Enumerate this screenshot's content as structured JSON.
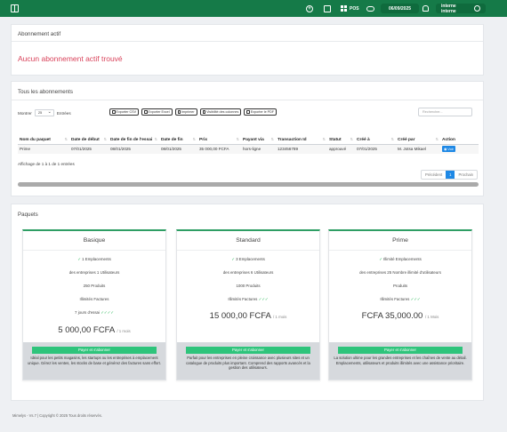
{
  "topbar": {
    "pos_label": "POS",
    "date": "06/09/2025",
    "user": "interne interne"
  },
  "active_subscription": {
    "title": "Abonnement actif",
    "empty_message": "Aucun abonnement actif trouvé"
  },
  "subscriptions": {
    "title": "Tous les abonnements",
    "show_label": "Montrer",
    "page_size": "25",
    "entries_label": "Entrées",
    "exports": [
      "Exporter CSV",
      "Exporter Excel",
      "Imprimer",
      "Visibilité des colonnes",
      "Exporter le PDF"
    ],
    "search_placeholder": "Rechercher...",
    "columns": [
      "Nom du paquet",
      "Date de début",
      "Date de fin de l'essai",
      "Date de fin",
      "Prix",
      "Payant via",
      "Transaction Id",
      "Statut",
      "Créé à",
      "Créé par",
      "Action"
    ],
    "rows": [
      {
        "package": "Prime",
        "start": "07/01/2025",
        "trial_end": "08/01/2025",
        "end": "08/01/2025",
        "price": "35 000,00 FCFA",
        "paid_via": "hors-ligne",
        "transaction_id": "123456789",
        "status": "approuvé",
        "created_at": "07/01/2025",
        "created_by": "M. Jotsa Mikael",
        "action": "Voir"
      }
    ],
    "info": "Affichage de 1 à 1 de 1 entrées",
    "pager": {
      "prev": "Précédent",
      "current": "1",
      "next": "Prochain"
    }
  },
  "packages": {
    "title": "Paquets",
    "items": [
      {
        "name": "Basique",
        "features": [
          "1 Emplacements",
          "des entreprises 1 Utilisateurs",
          "250 Produits",
          "Illimités Factures",
          "7 jours d'essai"
        ],
        "price": "5 000,00 FCFA",
        "period": "/ 1 mois",
        "button": "Payer et s'abonner",
        "description": "Idéal pour les petits magasins, les startups ou les entreprises à emplacement unique. Gérez les ventes, les stocks de base et générez des factures sans effort."
      },
      {
        "name": "Standard",
        "features": [
          "3 Emplacements",
          "des entreprises 6 Utilisateurs",
          "1000 Produits",
          "Illimités Factures"
        ],
        "price": "15 000,00 FCFA",
        "period": "/ 1 mois",
        "button": "Payer et s'abonner",
        "description": "Parfait pour les entreprises en pleine croissance avec plusieurs sites et un catalogue de produits plus important. Comprend des rapports avancés et la gestion des utilisateurs."
      },
      {
        "name": "Prime",
        "features": [
          "Illimité Emplacements",
          "des entreprises 25 Nombre illimité d'utilisateurs",
          "Produits",
          "Illimités Factures"
        ],
        "price": "FCFA 35,000.00",
        "period": "/ 1 Mois",
        "button": "Payer et s'abonner",
        "description": "La solution ultime pour les grandes entreprises et les chaînes de vente au détail. Emplacements, utilisateurs et produits illimités avec une assistance prioritaire."
      }
    ]
  },
  "footer": "Mimelys - Vs.7 | Copyright © 2025 Tous droits réservés."
}
